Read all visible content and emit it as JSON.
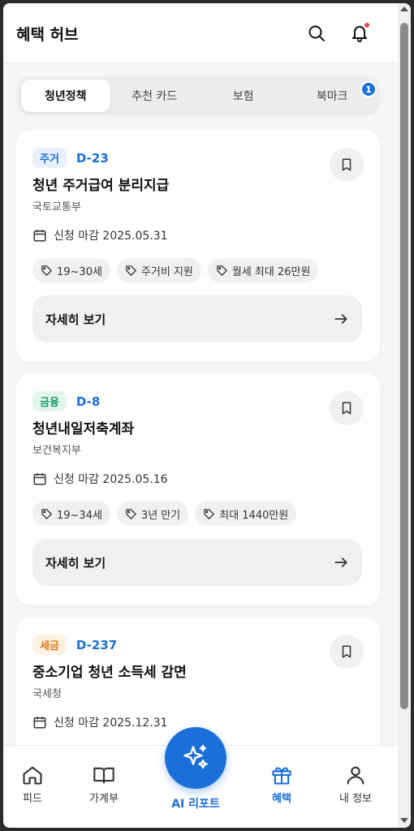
{
  "header": {
    "title": "혜택 허브"
  },
  "tabs": [
    {
      "label": "청년정책",
      "active": true
    },
    {
      "label": "추천 카드",
      "active": false
    },
    {
      "label": "보험",
      "active": false
    },
    {
      "label": "북마크",
      "active": false,
      "badge": "1"
    }
  ],
  "cards": [
    {
      "tag": "주거",
      "tag_color": "#1a6fd9",
      "dday": "D-23",
      "title": "청년 주거급여 분리지급",
      "org": "국토교통부",
      "deadline": "신청 마감 2025.05.31",
      "chips": [
        "19~30세",
        "주거비 지원",
        "월세 최대 26만원"
      ],
      "detail_label": "자세히 보기"
    },
    {
      "tag": "금융",
      "tag_color": "#1a9b63",
      "dday": "D-8",
      "title": "청년내일저축계좌",
      "org": "보건복지부",
      "deadline": "신청 마감 2025.05.16",
      "chips": [
        "19~34세",
        "3년 만기",
        "최대 1440만원"
      ],
      "detail_label": "자세히 보기"
    },
    {
      "tag": "세금",
      "tag_color": "#e07b1a",
      "dday": "D-237",
      "title": "중소기업 청년 소득세 감면",
      "org": "국세청",
      "deadline": "신청 마감 2025.12.31"
    }
  ],
  "nav": {
    "feed": "피드",
    "ledger": "가계부",
    "ai_report": "AI 리포트",
    "benefits": "혜택",
    "my_info": "내 정보"
  },
  "colors": {
    "primary": "#1a6fd9",
    "notification": "#ef4444"
  }
}
